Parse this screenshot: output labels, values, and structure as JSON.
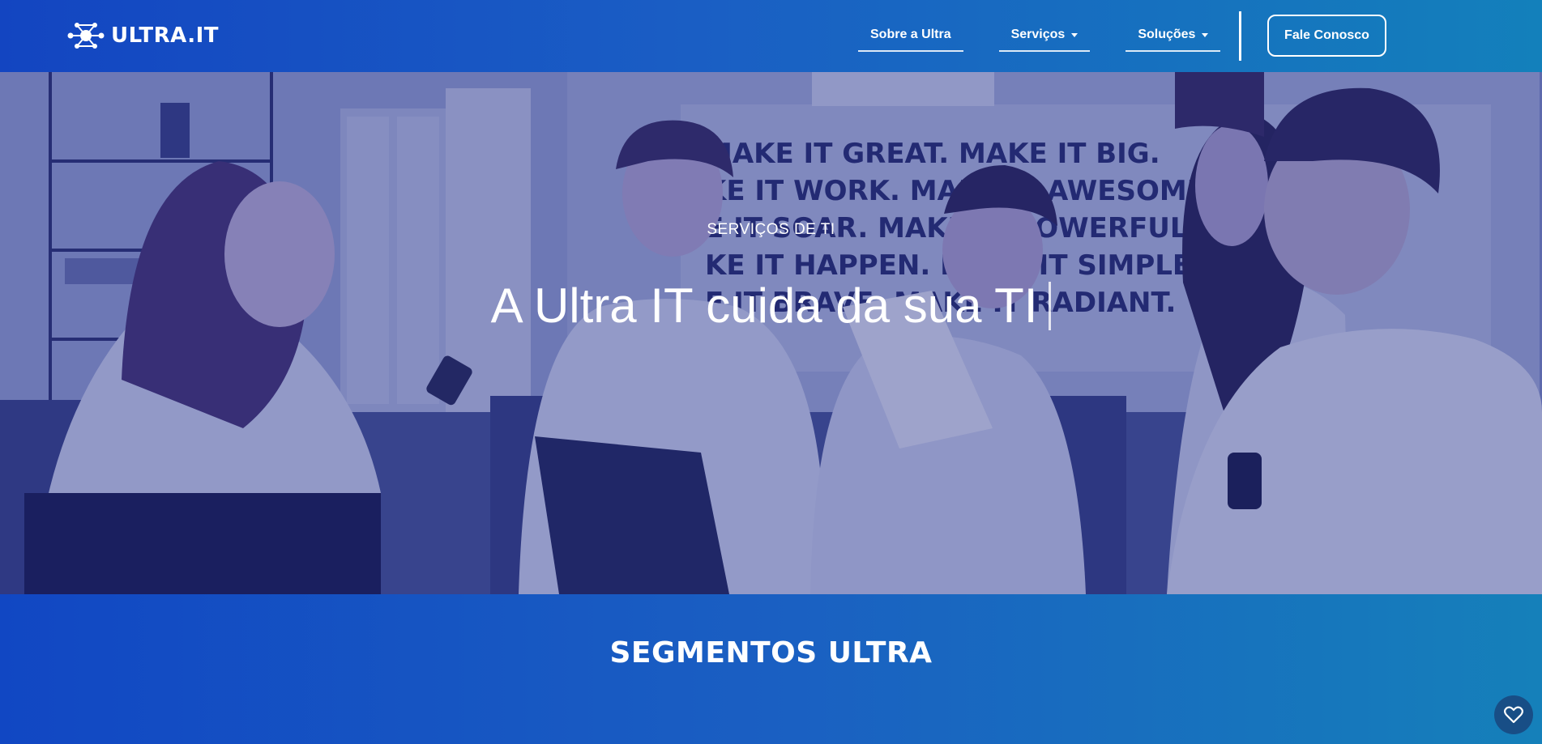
{
  "brand": {
    "name": "ULTRA.IT",
    "icon": "network-nodes-logo-icon"
  },
  "nav": {
    "items": [
      {
        "label": "Sobre a Ultra",
        "has_dropdown": false
      },
      {
        "label": "Serviços",
        "has_dropdown": true
      },
      {
        "label": "Soluções",
        "has_dropdown": true
      }
    ],
    "cta_label": "Fale Conosco"
  },
  "hero": {
    "eyebrow": "SERVIÇOS DE TI",
    "title": "A Ultra IT cuida da sua TI",
    "wall_text": [
      "MAKE IT GREAT. MAKE IT BIG.",
      "KE IT WORK. MAKE IT AWESOME.",
      "E IT SOAR. MAKE IT POWERFUL.",
      "KE IT HAPPEN. MAKE IT SIMPLE.",
      "E IT BRAVE. MAKE IT RADIANT."
    ]
  },
  "segments": {
    "title": "SEGMENTOS ULTRA"
  },
  "floating": {
    "icon": "heart-icon"
  },
  "colors": {
    "nav_gradient_start": "#1345c1",
    "nav_gradient_end": "#1380bb",
    "hero_tint": "#4a5aa8",
    "fav_button": "#184e86"
  }
}
